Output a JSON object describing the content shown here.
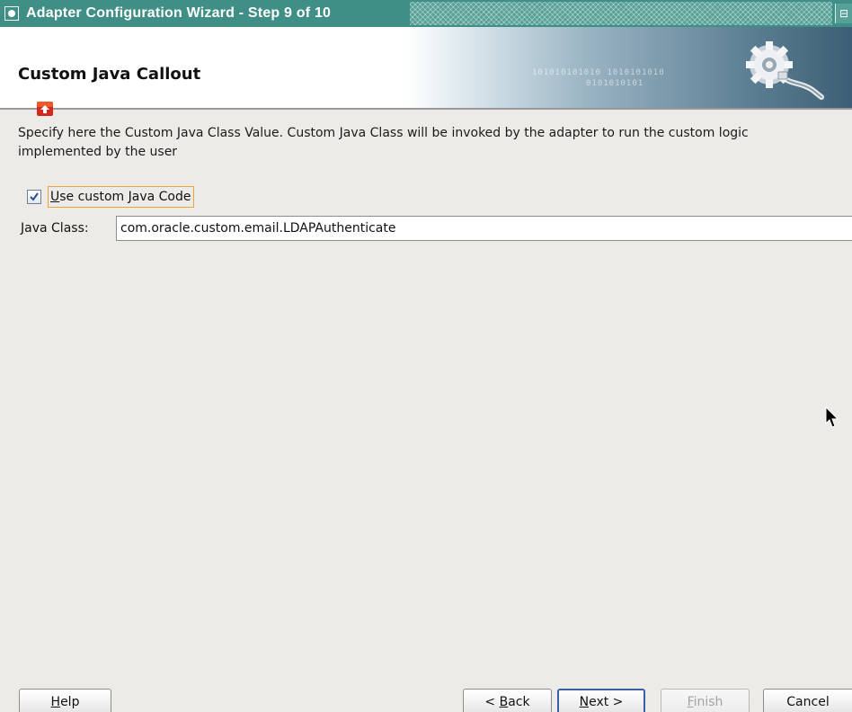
{
  "window": {
    "title": "Adapter Configuration Wizard - Step 9 of 10"
  },
  "header": {
    "title": "Custom Java Callout",
    "banner_text_1": "101010101010 1010101010",
    "banner_text_2": "0101010101"
  },
  "body": {
    "description": "Specify here the Custom Java Class Value. Custom Java Class will be invoked by the adapter to run the custom logic implemented by the user",
    "use_custom_code": {
      "label_mnemonic": "U",
      "label_rest": "se custom Java Code",
      "checked": true
    },
    "java_class": {
      "label_mnemonic": "J",
      "label_rest": "ava Class:",
      "value": "com.oracle.custom.email.LDAPAuthenticate"
    }
  },
  "buttons": {
    "help": {
      "mnemonic": "H",
      "rest": "elp"
    },
    "back": {
      "prefix": "< ",
      "mnemonic": "B",
      "rest": "ack"
    },
    "next": {
      "mnemonic": "N",
      "rest": "ext >"
    },
    "finish": {
      "mnemonic": "F",
      "rest": "inish",
      "enabled": false
    },
    "cancel": {
      "label": "Cancel"
    }
  },
  "colors": {
    "titlebar": "#3f8f86",
    "focus_outline": "#e8a33a",
    "default_button_border": "#3c5ea8"
  },
  "icons": [
    "system-menu-icon",
    "maximize-icon",
    "gear-plug-icon",
    "step-icon",
    "checkmark-icon",
    "mouse-cursor-icon"
  ]
}
